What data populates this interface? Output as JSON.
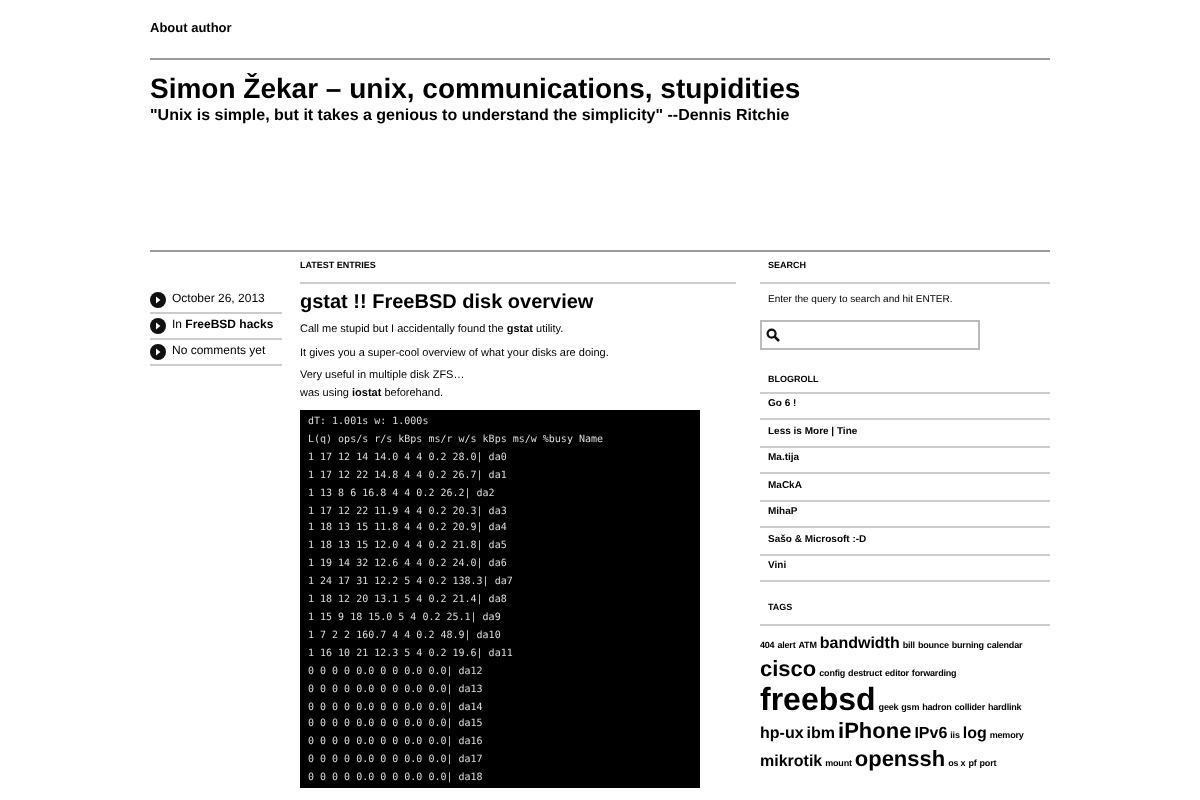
{
  "top_link": "About author",
  "site": {
    "title": "Simon Žekar – unix, communications, stupidities",
    "tagline": "\"Unix is simple, but it takes a genious to understand the simplicity\" --Dennis Ritchie"
  },
  "content": {
    "heading": "LATEST ENTRIES",
    "meta": [
      {
        "text": "October 26, 2013"
      },
      {
        "text": "In **FreeBSD hacks**"
      },
      {
        "text": "No comments yet"
      }
    ],
    "post": {
      "title": "gstat !! FreeBSD disk overview",
      "paragraphs": [
        "Call me stupid but I accidentally found the **gstat** utility.",
        "It gives you a super-cool overview of what your disks are doing.",
        "Very useful in multiple disk ZFS…\nwas using **iostat** beforehand."
      ],
      "terminal": [
        "dT: 1.001s w: 1.000s",
        "L(q) ops/s r/s kBps ms/r w/s kBps ms/w %busy Name",
        "1 17 12 14 14.0 4 4 0.2 28.0| da0",
        "1 17 12 22 14.8 4 4 0.2 26.7| da1",
        "1 13 8 6 16.8 4 4 0.2 26.2| da2",
        "1 17 12 22 11.9 4 4 0.2 20.3| da3",
        "1 18 13 15 11.8 4 4 0.2 20.9| da4",
        "1 18 13 15 12.0 4 4 0.2 21.8| da5",
        "1 19 14 32 12.6 4 4 0.2 24.0| da6",
        "1 24 17 31 12.2 5 4 0.2 138.3| da7",
        "1 18 12 20 13.1 5 4 0.2 21.4| da8",
        "1 15 9 18 15.0 5 4 0.2 25.1| da9",
        "1 7 2 2 160.7 4 4 0.2 48.9| da10",
        "1 16 10 21 12.3 5 4 0.2 19.6| da11",
        "0 0 0 0 0.0 0 0 0.0 0.0| da12",
        "0 0 0 0 0.0 0 0 0.0 0.0| da13",
        "0 0 0 0 0.0 0 0 0.0 0.0| da14",
        "0 0 0 0 0.0 0 0 0.0 0.0| da15",
        "0 0 0 0 0.0 0 0 0.0 0.0| da16",
        "0 0 0 0 0.0 0 0 0.0 0.0| da17",
        "0 0 0 0 0.0 0 0 0.0 0.0| da18"
      ]
    }
  },
  "sidebar": {
    "search": {
      "heading": "SEARCH",
      "hint": "Enter the query to search and hit ENTER."
    },
    "blogroll": {
      "heading": "BLOGROLL",
      "items": [
        "Go 6 !",
        "Less is More | Tine",
        "Ma.tija",
        "MaCkA",
        "MihaP",
        "Sašo & Microsoft :-D",
        "Vini"
      ]
    },
    "tags": {
      "heading": "TAGS",
      "items": [
        {
          "text": "404",
          "kind": "small"
        },
        {
          "text": "alert",
          "kind": "small"
        },
        {
          "text": "ATM",
          "kind": "small"
        },
        {
          "text": "bandwidth",
          "kind": "medium"
        },
        {
          "text": "bill",
          "kind": "small"
        },
        {
          "text": "bounce",
          "kind": "small"
        },
        {
          "text": "burning",
          "kind": "small"
        },
        {
          "text": "calendar",
          "kind": "small"
        },
        {
          "text": "cisco",
          "kind": "large"
        },
        {
          "text": "config",
          "kind": "small"
        },
        {
          "text": "destruct",
          "kind": "small"
        },
        {
          "text": "editor",
          "kind": "small"
        },
        {
          "text": "forwarding",
          "kind": "small"
        },
        {
          "text": "freebsd",
          "kind": "huge"
        },
        {
          "text": "geek",
          "kind": "small"
        },
        {
          "text": "gsm",
          "kind": "small"
        },
        {
          "text": "hadron",
          "kind": "small"
        },
        {
          "text": "collider",
          "kind": "small"
        },
        {
          "text": "hardlink",
          "kind": "small"
        },
        {
          "text": "hp-ux",
          "kind": "medium"
        },
        {
          "text": "ibm",
          "kind": "medium"
        },
        {
          "text": "iPhone",
          "kind": "large"
        },
        {
          "text": "IPv6",
          "kind": "medium"
        },
        {
          "text": "iis",
          "kind": "small"
        },
        {
          "text": "log",
          "kind": "medium"
        },
        {
          "text": "memory",
          "kind": "small"
        },
        {
          "text": "mikrotik",
          "kind": "medium"
        },
        {
          "text": "mount",
          "kind": "small"
        },
        {
          "text": "openssh",
          "kind": "large"
        },
        {
          "text": "os x",
          "kind": "small"
        },
        {
          "text": "pf",
          "kind": "small"
        },
        {
          "text": "port",
          "kind": "small"
        }
      ]
    }
  }
}
